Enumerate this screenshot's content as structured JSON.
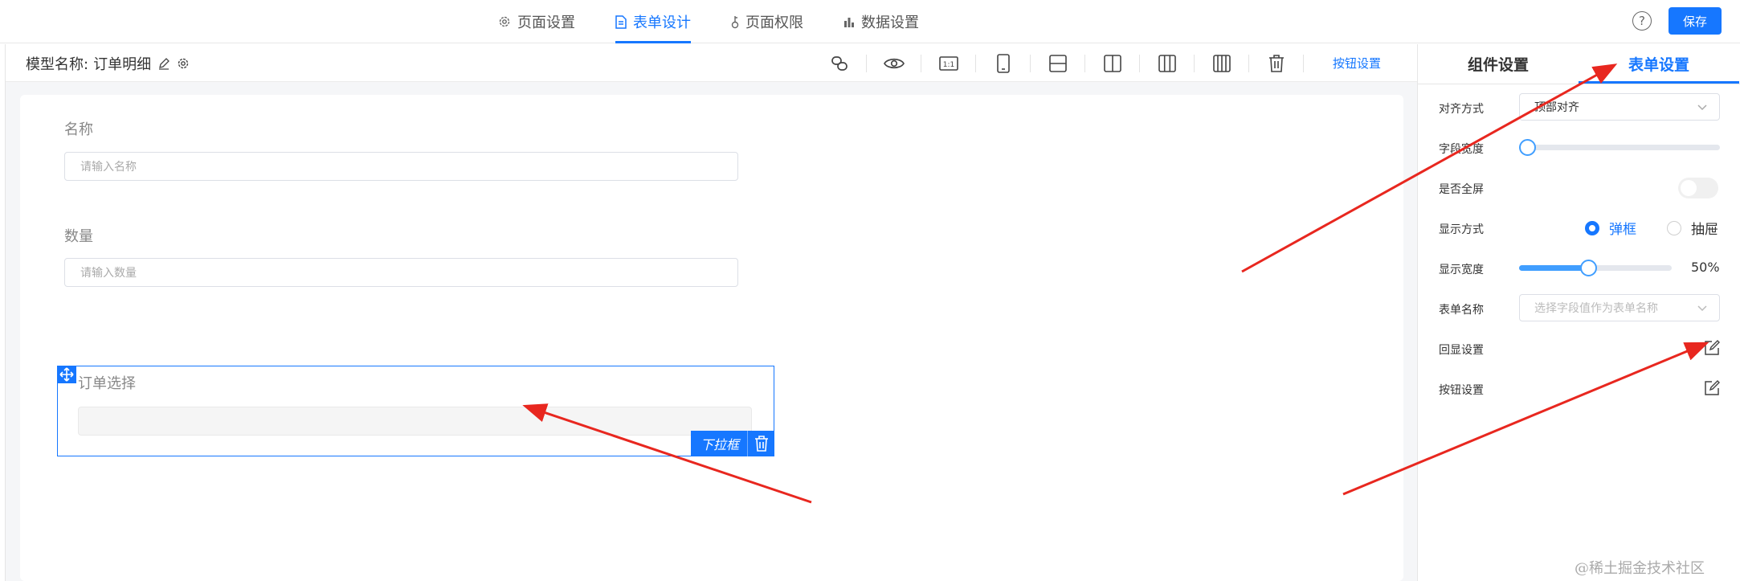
{
  "nav": {
    "tabs": [
      {
        "label": "页面设置",
        "icon": "gear-icon"
      },
      {
        "label": "表单设计",
        "icon": "document-icon"
      },
      {
        "label": "页面权限",
        "icon": "key-icon"
      },
      {
        "label": "数据设置",
        "icon": "bar-chart-icon"
      }
    ],
    "active_tab": 1,
    "save_label": "保存",
    "help_label": "?"
  },
  "toolbar": {
    "model_label": "模型名称:",
    "model_name": "订单明细",
    "button_settings_label": "按钮设置",
    "tools": [
      "link-icon",
      "eye-icon",
      "ratio-icon",
      "mobile-icon",
      "layout-one-column-icon",
      "layout-two-columns-icon",
      "layout-three-columns-icon",
      "layout-four-columns-icon",
      "trash-icon"
    ],
    "ratio_text": "1:1"
  },
  "form": {
    "fields": [
      {
        "label": "名称",
        "placeholder": "请输入名称"
      },
      {
        "label": "数量",
        "placeholder": "请输入数量"
      }
    ],
    "selected_field": {
      "label": "订单选择",
      "type_badge": "下拉框"
    }
  },
  "panel": {
    "tabs": [
      {
        "label": "组件设置"
      },
      {
        "label": "表单设置"
      }
    ],
    "active_tab": 1,
    "align": {
      "label": "对齐方式",
      "value": "顶部对齐"
    },
    "field_width": {
      "label": "字段宽度",
      "fraction": 0.0
    },
    "fullscreen": {
      "label": "是否全屏",
      "on": false
    },
    "display_mode": {
      "label": "显示方式",
      "options": [
        "弹框",
        "抽屉"
      ],
      "selected": 0
    },
    "display_width": {
      "label": "显示宽度",
      "value_text": "50%",
      "fraction": 0.45
    },
    "form_name": {
      "label": "表单名称",
      "placeholder": "选择字段值作为表单名称"
    },
    "echo_settings": {
      "label": "回显设置"
    },
    "button_settings": {
      "label": "按钮设置"
    }
  },
  "colors": {
    "accent": "#1677ff",
    "annotation_arrow": "#e8271f"
  },
  "watermark": "@稀土掘金技术社区"
}
